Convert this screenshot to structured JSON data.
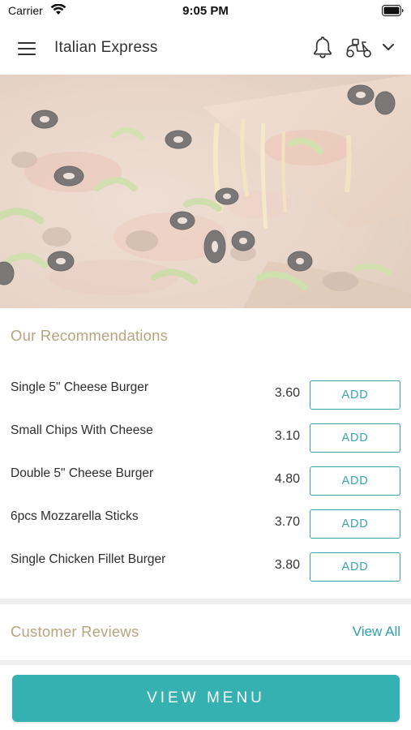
{
  "status_bar": {
    "carrier": "Carrier",
    "time": "9:05 PM"
  },
  "header": {
    "title": "Italian Express"
  },
  "recommendations": {
    "title": "Our Recommendations",
    "items": [
      {
        "name": "Single 5\" Cheese Burger",
        "price": "3.60",
        "button": "ADD"
      },
      {
        "name": "Small Chips With Cheese",
        "price": "3.10",
        "button": "ADD"
      },
      {
        "name": "Double 5\" Cheese Burger",
        "price": "4.80",
        "button": "ADD"
      },
      {
        "name": "6pcs Mozzarella Sticks",
        "price": "3.70",
        "button": "ADD"
      },
      {
        "name": "Single Chicken Fillet Burger",
        "price": "3.80",
        "button": "ADD"
      }
    ]
  },
  "reviews": {
    "title": "Customer Reviews",
    "view_all": "View All"
  },
  "footer": {
    "view_menu": "VIEW MENU"
  },
  "colors": {
    "accent": "#36b1b1",
    "section_title": "#b6a57f",
    "link": "#2e9fb0"
  },
  "icons": [
    "menu-icon",
    "bell-icon",
    "scooter-icon",
    "chevron-down-icon"
  ]
}
